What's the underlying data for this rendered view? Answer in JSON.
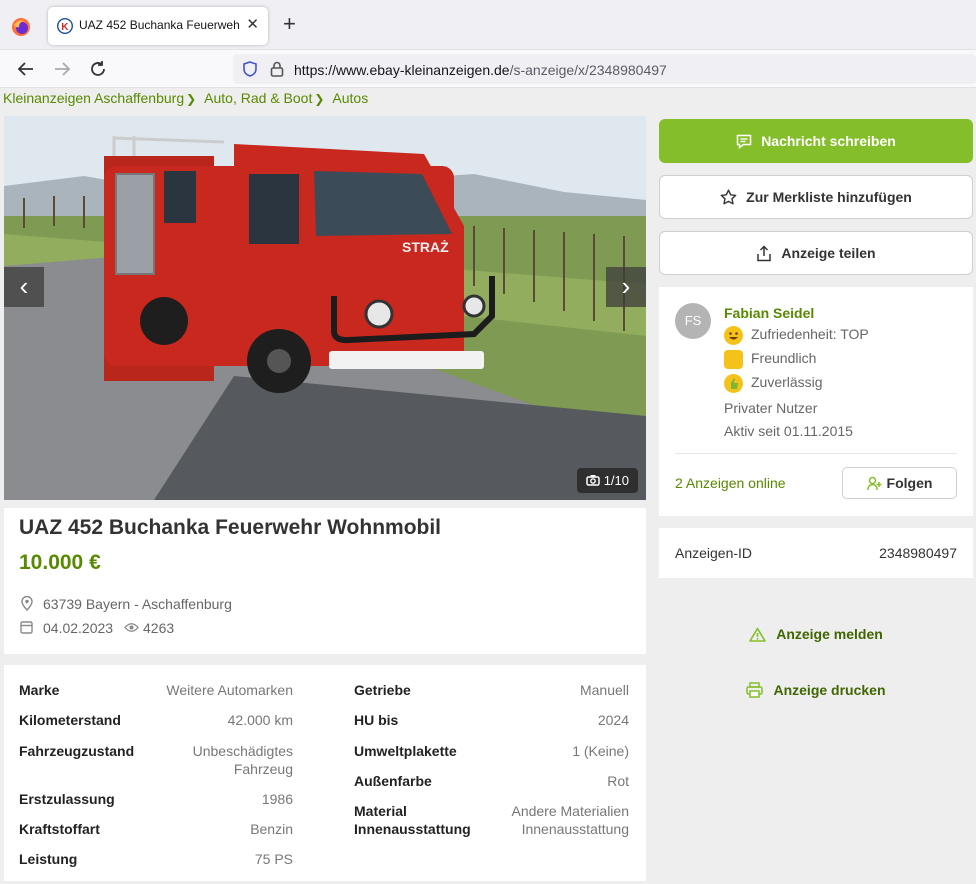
{
  "browser": {
    "tab_title": "UAZ 452 Buchanka Feuerwehr Wohnmobil",
    "tab_close": "✕",
    "new_tab": "+",
    "url_host": "https://www.ebay-kleinanzeigen.de",
    "url_path": "/s-anzeige/x/2348980497"
  },
  "breadcrumb": [
    "Kleinanzeigen Aschaffenburg",
    "Auto, Rad & Boot",
    "Autos"
  ],
  "gallery": {
    "counter": "1/10",
    "prev": "‹",
    "next": "›"
  },
  "listing": {
    "title": "UAZ 452 Buchanka Feuerwehr Wohnmobil",
    "price": "10.000 €",
    "location": "63739 Bayern - Aschaffenburg",
    "date": "04.02.2023",
    "views": "4263"
  },
  "details_left": [
    {
      "key": "Marke",
      "value": "Weitere Automarken"
    },
    {
      "key": "Kilometerstand",
      "value": "42.000 km"
    },
    {
      "key": "Fahrzeugzustand",
      "value": "Unbeschädigtes Fahrzeug"
    },
    {
      "key": "Erstzulassung",
      "value": "1986"
    },
    {
      "key": "Kraftstoffart",
      "value": "Benzin"
    },
    {
      "key": "Leistung",
      "value": "75 PS"
    }
  ],
  "details_right": [
    {
      "key": "Getriebe",
      "value": "Manuell"
    },
    {
      "key": "HU bis",
      "value": "2024"
    },
    {
      "key": "Umweltplakette",
      "value": "1 (Keine)"
    },
    {
      "key": "Außenfarbe",
      "value": "Rot"
    },
    {
      "key": "Material Innenausstattung",
      "value": "Andere Materialien Innenausstattung"
    }
  ],
  "actions": {
    "message": "Nachricht schreiben",
    "watchlist": "Zur Merkliste hinzufügen",
    "share": "Anzeige teilen",
    "report": "Anzeige melden",
    "print": "Anzeige drucken"
  },
  "seller": {
    "initials": "FS",
    "name": "Fabian Seidel",
    "badges": [
      "Zufriedenheit: TOP",
      "Freundlich",
      "Zuverlässig"
    ],
    "type": "Privater Nutzer",
    "active_since": "Aktiv seit 01.11.2015",
    "ads_online": "2 Anzeigen online",
    "follow": "Folgen"
  },
  "ad_id": {
    "label": "Anzeigen-ID",
    "value": "2348980497"
  },
  "colors": {
    "brand_green": "#84bf2b",
    "link_green": "#578a00",
    "truck_red": "#c8281e"
  }
}
